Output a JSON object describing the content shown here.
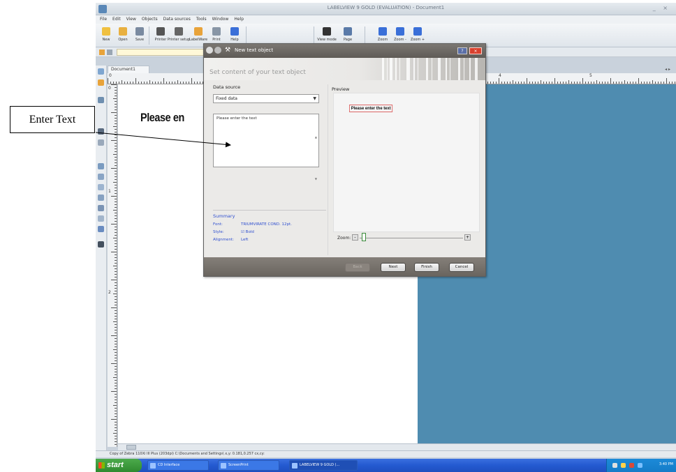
{
  "callout": {
    "text": "Enter Text"
  },
  "app": {
    "title": "LABELVIEW 9 GOLD (EVALUATION) - Document1",
    "window_controls": "_ ×"
  },
  "menu": [
    "File",
    "Edit",
    "View",
    "Objects",
    "Data sources",
    "Tools",
    "Window",
    "Help"
  ],
  "toolbar": [
    {
      "label": "New",
      "icon": "new-icon",
      "color": "#f0c040"
    },
    {
      "label": "Open",
      "icon": "folder-icon",
      "color": "#e8b040"
    },
    {
      "label": "Save",
      "icon": "save-icon",
      "color": "#7a8aa0"
    },
    {
      "label": "Printer",
      "icon": "printer-icon",
      "color": "#555"
    },
    {
      "label": "Printer setup",
      "icon": "printer-setup-icon",
      "color": "#666"
    },
    {
      "label": "LabelWare",
      "icon": "labelware-icon",
      "color": "#e8a33a"
    },
    {
      "label": "Print",
      "icon": "print-icon",
      "color": "#8896a6"
    },
    {
      "label": "Help",
      "icon": "help-icon",
      "color": "#3a6fd8"
    },
    {
      "label": "View mode",
      "icon": "view-mode-icon",
      "color": "#333"
    },
    {
      "label": "Page",
      "icon": "page-icon",
      "color": "#5a7aa8"
    },
    {
      "label": "Zoom",
      "icon": "zoom-icon",
      "color": "#3a6fd8"
    },
    {
      "label": "Zoom -",
      "icon": "zoom-out-icon",
      "color": "#3a6fd8"
    },
    {
      "label": "Zoom +",
      "icon": "zoom-in-icon",
      "color": "#3a6fd8"
    }
  ],
  "document": {
    "tab": "Document1",
    "scroll_arrows": "◂ ▸",
    "label_text": "Please en"
  },
  "ruler": {
    "top_numbers": [
      "0",
      "4",
      "5"
    ],
    "left_numbers": [
      "0",
      "1",
      "2"
    ]
  },
  "statusbar": {
    "text": "Copy of Zebra 110Xi III Plus (203dpi) C:\\Documents and Settings\\   x,y: 0.181,0.257   cx,cy:"
  },
  "taskbar": {
    "start": "start",
    "tasks": [
      "CD Interface",
      "ScreenPrint",
      "LABELVIEW 9 GOLD (..."
    ],
    "clock": "3:40 PM"
  },
  "dialog": {
    "title": "New text object",
    "title_icon": "⚒",
    "help": "?",
    "close": "×",
    "subtitle": "Set content of your text object",
    "data_source_label": "Data source",
    "data_source_value": "Fixed data",
    "text_value": "Please enter the text",
    "preview_label": "Preview",
    "preview_text": "Please enter the text",
    "summary_title": "Summary",
    "summary": [
      {
        "key": "Font:",
        "value": "TRIUMVIRATE COND. 12pt."
      },
      {
        "key": "Style:",
        "value": "☑ Bold"
      },
      {
        "key": "Alignment:",
        "value": "Left"
      }
    ],
    "zoom_label": "Zoom:",
    "zoom_level": 0.02,
    "buttons": {
      "back": "Back",
      "next": "Next",
      "finish": "Finish",
      "cancel": "Cancel"
    }
  }
}
